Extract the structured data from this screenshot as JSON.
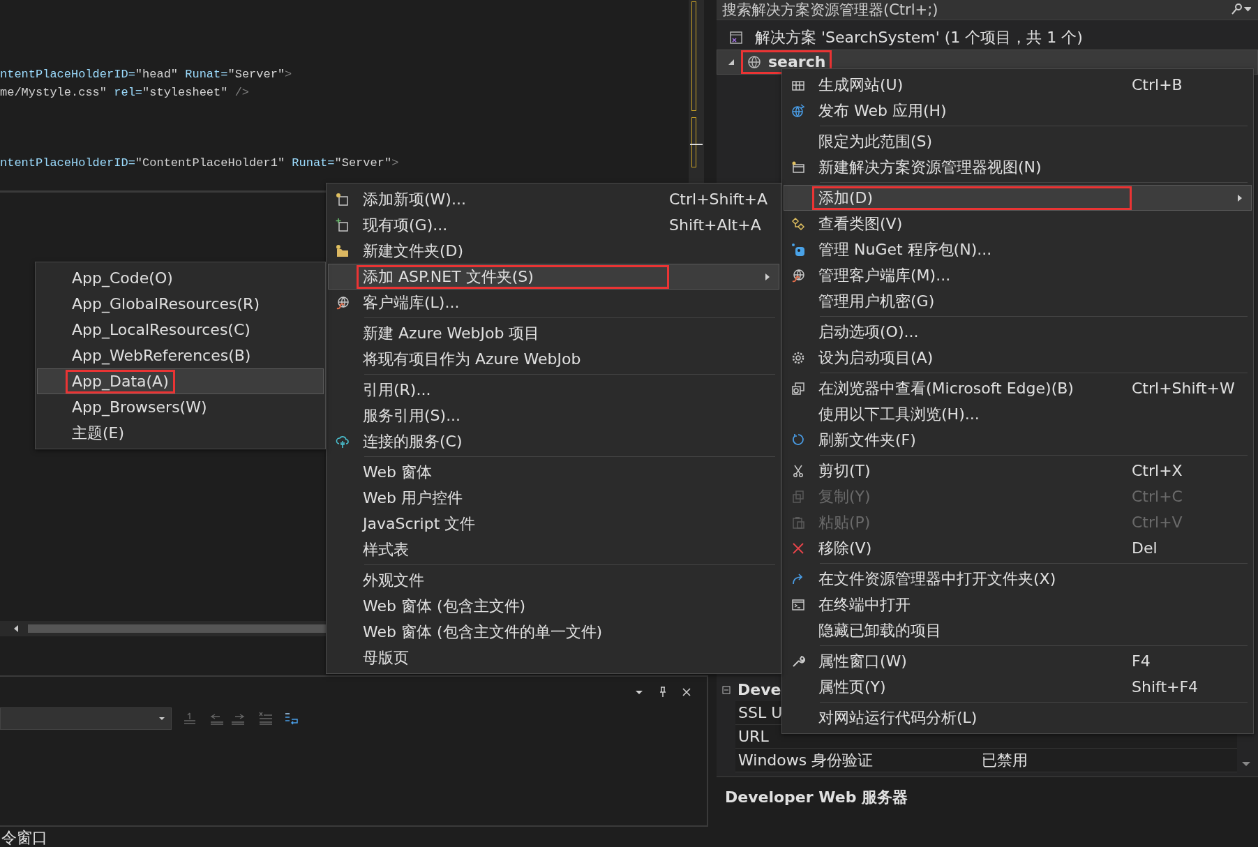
{
  "editor": {
    "code_blocks": [
      [
        [
          {
            "kind": "attr",
            "text": "ntentPlaceHolderID="
          },
          {
            "kind": "value",
            "text": "\"head\""
          },
          {
            "kind": "attr",
            "text": " Runat="
          },
          {
            "kind": "value",
            "text": "\"Server\""
          },
          {
            "kind": "punct",
            "text": ">"
          }
        ],
        [
          {
            "kind": "value",
            "text": "me/Mystyle.css\""
          },
          {
            "kind": "attr",
            "text": " rel="
          },
          {
            "kind": "value",
            "text": "\"stylesheet\""
          },
          {
            "kind": "punct",
            "text": " />"
          }
        ]
      ],
      [
        [
          {
            "kind": "attr",
            "text": "ntentPlaceHolderID="
          },
          {
            "kind": "value",
            "text": "\"ContentPlaceHolder1\""
          },
          {
            "kind": "attr",
            "text": " Runat="
          },
          {
            "kind": "value",
            "text": "\"Server\""
          },
          {
            "kind": "punct",
            "text": ">"
          }
        ]
      ]
    ]
  },
  "output_panel": {
    "caption": "令窗口"
  },
  "solution_explorer": {
    "search_placeholder": "搜索解决方案资源管理器(Ctrl+;)",
    "items": [
      {
        "kind": "solution",
        "label": "解决方案 'SearchSystem' (1 个项目，共 1 个)",
        "selected": false,
        "highlighted": false
      },
      {
        "kind": "project",
        "label": "search",
        "selected": true,
        "highlighted": true
      }
    ]
  },
  "properties": {
    "group": "Deve",
    "expanded": true,
    "rows": [
      {
        "name": "SSL U"
      },
      {
        "name": "URL"
      },
      {
        "name": "Windows 身份验证",
        "value": "已禁用"
      }
    ],
    "description_title": "Developer Web 服务器"
  },
  "context_menu": {
    "items": [
      {
        "kind": "item",
        "label": "生成网站(U)",
        "shortcut": "Ctrl+B",
        "selected": false,
        "disabled": false,
        "highlighted": false
      },
      {
        "kind": "item",
        "label": "发布 Web 应用(H)",
        "selected": false,
        "disabled": false,
        "highlighted": false
      },
      {
        "kind": "separator"
      },
      {
        "kind": "item",
        "label": "限定为此范围(S)",
        "selected": false,
        "disabled": false,
        "highlighted": false
      },
      {
        "kind": "item",
        "label": "新建解决方案资源管理器视图(N)",
        "selected": false,
        "disabled": false,
        "highlighted": false
      },
      {
        "kind": "separator"
      },
      {
        "kind": "item",
        "label": "添加(D)",
        "submenu": true,
        "selected": true,
        "disabled": false,
        "highlighted": true
      },
      {
        "kind": "item",
        "label": "查看类图(V)",
        "selected": false,
        "disabled": false,
        "highlighted": false
      },
      {
        "kind": "item",
        "label": "管理 NuGet 程序包(N)...",
        "selected": false,
        "disabled": false,
        "highlighted": false
      },
      {
        "kind": "item",
        "label": "管理客户端库(M)...",
        "selected": false,
        "disabled": false,
        "highlighted": false
      },
      {
        "kind": "item",
        "label": "管理用户机密(G)",
        "selected": false,
        "disabled": false,
        "highlighted": false
      },
      {
        "kind": "separator"
      },
      {
        "kind": "item",
        "label": "启动选项(O)...",
        "selected": false,
        "disabled": false,
        "highlighted": false
      },
      {
        "kind": "item",
        "label": "设为启动项目(A)",
        "selected": false,
        "disabled": false,
        "highlighted": false
      },
      {
        "kind": "separator"
      },
      {
        "kind": "item",
        "label": "在浏览器中查看(Microsoft Edge)(B)",
        "shortcut": "Ctrl+Shift+W",
        "selected": false,
        "disabled": false,
        "highlighted": false
      },
      {
        "kind": "item",
        "label": "使用以下工具浏览(H)...",
        "selected": false,
        "disabled": false,
        "highlighted": false
      },
      {
        "kind": "item",
        "label": "刷新文件夹(F)",
        "selected": false,
        "disabled": false,
        "highlighted": false
      },
      {
        "kind": "separator"
      },
      {
        "kind": "item",
        "label": "剪切(T)",
        "shortcut": "Ctrl+X",
        "selected": false,
        "disabled": false,
        "highlighted": false
      },
      {
        "kind": "item",
        "label": "复制(Y)",
        "shortcut": "Ctrl+C",
        "selected": false,
        "disabled": true,
        "highlighted": false
      },
      {
        "kind": "item",
        "label": "粘贴(P)",
        "shortcut": "Ctrl+V",
        "selected": false,
        "disabled": true,
        "highlighted": false
      },
      {
        "kind": "item",
        "label": "移除(V)",
        "shortcut": "Del",
        "selected": false,
        "disabled": false,
        "highlighted": false
      },
      {
        "kind": "separator"
      },
      {
        "kind": "item",
        "label": "在文件资源管理器中打开文件夹(X)",
        "selected": false,
        "disabled": false,
        "highlighted": false
      },
      {
        "kind": "item",
        "label": "在终端中打开",
        "selected": false,
        "disabled": false,
        "highlighted": false
      },
      {
        "kind": "item",
        "label": "隐藏已卸载的项目",
        "selected": false,
        "disabled": false,
        "highlighted": false
      },
      {
        "kind": "separator"
      },
      {
        "kind": "item",
        "label": "属性窗口(W)",
        "shortcut": "F4",
        "selected": false,
        "disabled": false,
        "highlighted": false
      },
      {
        "kind": "item",
        "label": "属性页(Y)",
        "shortcut": "Shift+F4",
        "selected": false,
        "disabled": false,
        "highlighted": false
      },
      {
        "kind": "separator"
      },
      {
        "kind": "item",
        "label": "对网站运行代码分析(L)",
        "selected": false,
        "disabled": false,
        "highlighted": false
      }
    ]
  },
  "add_submenu": {
    "items": [
      {
        "kind": "item",
        "label": "添加新项(W)...",
        "shortcut": "Ctrl+Shift+A",
        "selected": false,
        "highlighted": false
      },
      {
        "kind": "item",
        "label": "现有项(G)...",
        "shortcut": "Shift+Alt+A",
        "selected": false,
        "highlighted": false
      },
      {
        "kind": "item",
        "label": "新建文件夹(D)",
        "selected": false,
        "highlighted": false
      },
      {
        "kind": "item",
        "label": "添加 ASP.NET 文件夹(S)",
        "submenu": true,
        "selected": true,
        "highlighted": true
      },
      {
        "kind": "item",
        "label": "客户端库(L)...",
        "selected": false,
        "highlighted": false
      },
      {
        "kind": "separator"
      },
      {
        "kind": "item",
        "label": "新建 Azure WebJob 项目",
        "selected": false,
        "highlighted": false
      },
      {
        "kind": "item",
        "label": "将现有项目作为 Azure WebJob",
        "selected": false,
        "highlighted": false
      },
      {
        "kind": "separator"
      },
      {
        "kind": "item",
        "label": "引用(R)...",
        "selected": false,
        "highlighted": false
      },
      {
        "kind": "item",
        "label": "服务引用(S)...",
        "selected": false,
        "highlighted": false
      },
      {
        "kind": "item",
        "label": "连接的服务(C)",
        "selected": false,
        "highlighted": false
      },
      {
        "kind": "separator"
      },
      {
        "kind": "item",
        "label": "Web 窗体",
        "selected": false,
        "highlighted": false
      },
      {
        "kind": "item",
        "label": "Web 用户控件",
        "selected": false,
        "highlighted": false
      },
      {
        "kind": "item",
        "label": "JavaScript 文件",
        "selected": false,
        "highlighted": false
      },
      {
        "kind": "item",
        "label": "样式表",
        "selected": false,
        "highlighted": false
      },
      {
        "kind": "separator"
      },
      {
        "kind": "item",
        "label": "外观文件",
        "selected": false,
        "highlighted": false
      },
      {
        "kind": "item",
        "label": "Web 窗体 (包含主文件)",
        "selected": false,
        "highlighted": false
      },
      {
        "kind": "item",
        "label": "Web 窗体 (包含主文件的单一文件)",
        "selected": false,
        "highlighted": false
      },
      {
        "kind": "item",
        "label": "母版页",
        "selected": false,
        "highlighted": false
      }
    ]
  },
  "aspnet_submenu": {
    "items": [
      {
        "kind": "item",
        "label": "App_Code(O)",
        "selected": false,
        "highlighted": false
      },
      {
        "kind": "item",
        "label": "App_GlobalResources(R)",
        "selected": false,
        "highlighted": false
      },
      {
        "kind": "item",
        "label": "App_LocalResources(C)",
        "selected": false,
        "highlighted": false
      },
      {
        "kind": "item",
        "label": "App_WebReferences(B)",
        "selected": false,
        "highlighted": false
      },
      {
        "kind": "item",
        "label": "App_Data(A)",
        "selected": true,
        "highlighted": true
      },
      {
        "kind": "item",
        "label": "App_Browsers(W)",
        "selected": false,
        "highlighted": false
      },
      {
        "kind": "item",
        "label": "主题(E)",
        "selected": false,
        "highlighted": false
      }
    ]
  }
}
